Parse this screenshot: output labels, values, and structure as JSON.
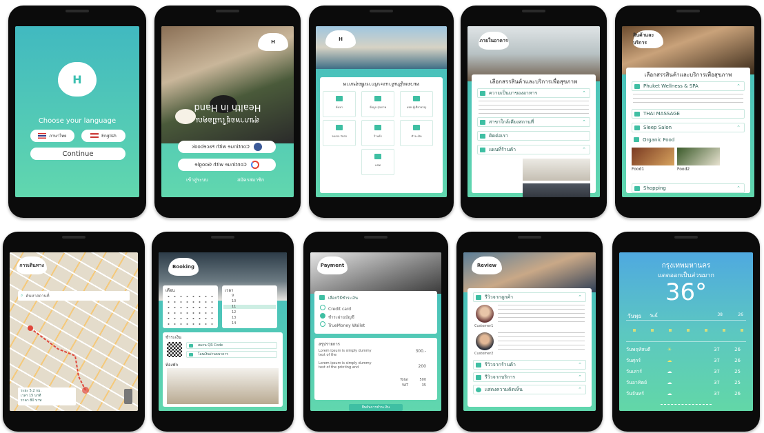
{
  "language_screen": {
    "logo_letter": "H",
    "prompt": "Choose your language",
    "thai_label": "ภาษาไทย",
    "english_label": "English",
    "continue_label": "Continue"
  },
  "login_screen": {
    "title_en": "Health in Hand",
    "title_th": "สุขภาพอยู่ในมือคุณ",
    "facebook_label": "Continue with Facebook",
    "google_label": "Continue with Google",
    "register_label": "สมัครสมาชิก",
    "login_label": "เข้าสู่ระบบ"
  },
  "category_screen": {
    "header": "หมวดหมู่สินค้าและบริการเพื่อสุขภาพ",
    "tiles": [
      "ค้นหา",
      "ข้อมูล สุขภาพ",
      "แชท ผู้เชี่ยวชาญ",
      "จองรถ รับส่ง",
      "ร้านค้า",
      "ชำระเงิน",
      "แชท"
    ]
  },
  "service_screen": {
    "badge": "ภายในอาคาร",
    "header": "เลือกสรรสินค้าและบริการเพื่อสุขภาพ",
    "items": [
      "ความเป็นมาของอาหาร",
      "สาขาใกล้เคียงสถานที่",
      "ติดต่อเรา",
      "แผนที่ร้านค้า"
    ]
  },
  "shop_screen": {
    "badge": "สินค้าและบริการ",
    "header": "เลือกสรรสินค้าและบริการเพื่อสุขภาพ",
    "items": [
      "Phuket Wellness & SPA",
      "THAI MASSAGE",
      "Sleep Salon",
      "Organic Food",
      "Shopping"
    ],
    "food_labels": [
      "Food1",
      "Food2"
    ]
  },
  "map_screen": {
    "badge": "การเดินทาง",
    "search_placeholder": "ค้นหาสถานที่",
    "info_lines": [
      "ระยะ 5.2 กม.",
      "เวลา 15 นาที",
      "ราคา 80 บาท"
    ]
  },
  "booking_screen": {
    "badge": "Booking",
    "month_label": "เดือน",
    "time_label": "เวลา",
    "times": [
      "9",
      "10",
      "11",
      "12",
      "13",
      "14"
    ],
    "payment_label": "ชำระเงิน",
    "qr_option": "สแกน QR Code",
    "bank_option": "โอนเงินผ่านธนาคาร",
    "room_label": "ห้องพัก"
  },
  "payment_screen": {
    "badge": "Payment",
    "method_header": "เลือกวิธีชำระเงิน",
    "methods": [
      "Credit card",
      "ชำระผ่านบัญชี",
      "TrueMoney Wallet"
    ],
    "summary_header": "สรุปรายการ",
    "lines": [
      {
        "desc": "Lorem ipsum is simply dummy text of the",
        "price": "300.-"
      },
      {
        "desc": "Lorem ipsum is simply dummy text of the printing and",
        "price": "200"
      }
    ],
    "total_label": "Total",
    "total_value": "500",
    "vat_label": "VAT",
    "vat_value": "35",
    "confirm_label": "ยืนยันการชำระเงิน"
  },
  "review_screen": {
    "badge": "Review",
    "review_header": "รีวิวจากลูกค้า",
    "reviewers": [
      "Customer1",
      "Customer2"
    ],
    "items": [
      "รีวิวจากร้านค้า",
      "รีวิวจากบริการ",
      "แสดงความคิดเห็น"
    ]
  },
  "weather_screen": {
    "city": "กรุงเทพมหานคร",
    "condition": "แดดออกเป็นส่วนมาก",
    "temperature": "36°",
    "today": "วันพุธ",
    "today_label": "วันนี้",
    "high": "38",
    "low": "26",
    "days": [
      {
        "name": "วันพฤหัสบดี",
        "hi": "37",
        "lo": "26"
      },
      {
        "name": "วันศุกร์",
        "hi": "37",
        "lo": "26"
      },
      {
        "name": "วันเสาร์",
        "hi": "37",
        "lo": "25"
      },
      {
        "name": "วันอาทิตย์",
        "hi": "37",
        "lo": "25"
      },
      {
        "name": "วันจันทร์",
        "hi": "37",
        "lo": "26"
      }
    ]
  },
  "colors": {
    "accent": "#5fd1b0",
    "teal_top": "#41b9c0",
    "weather_top": "#4fa9e0"
  }
}
